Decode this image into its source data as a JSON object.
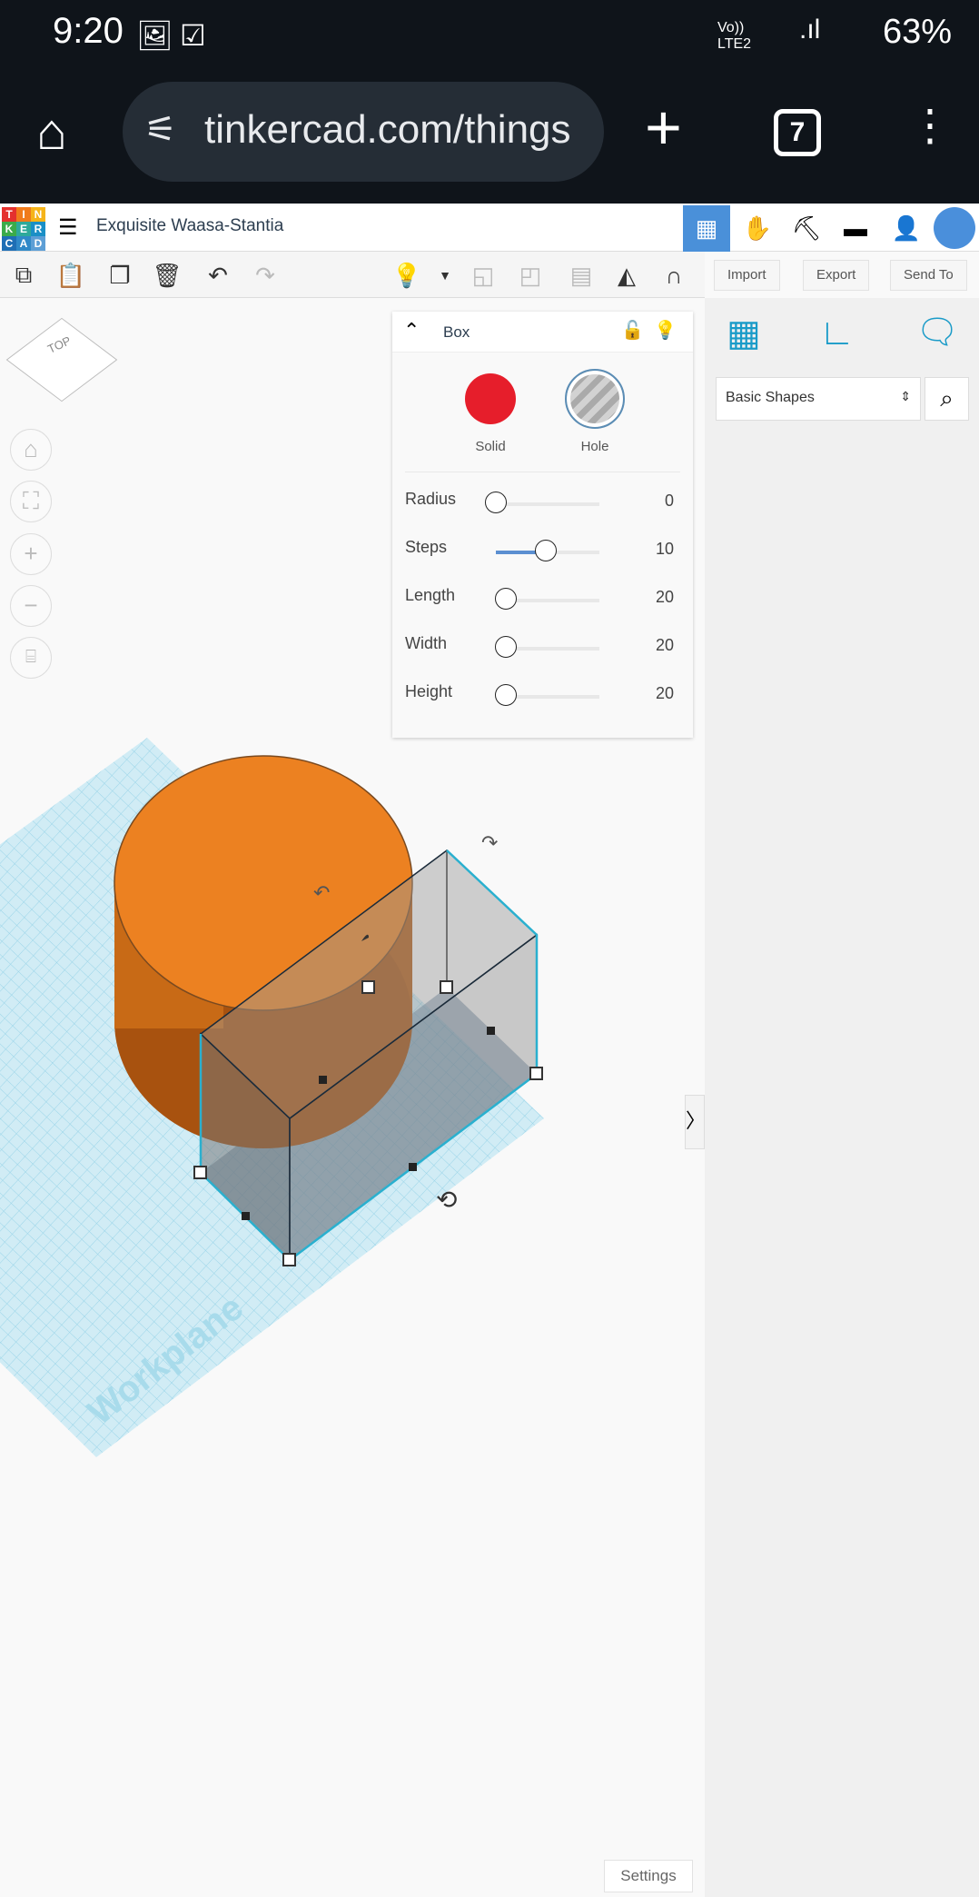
{
  "status_bar": {
    "time": "9:20",
    "battery": "63%",
    "network": "Vo)) LTE2"
  },
  "browser": {
    "url": "tinkercad.com/things",
    "tab_count": "7"
  },
  "app": {
    "title": "Exquisite Waasa-Stantia",
    "logo": [
      "T",
      "I",
      "N",
      "K",
      "E",
      "R",
      "C",
      "A",
      "D"
    ]
  },
  "toolbar": {
    "import": "Import",
    "export": "Export",
    "send_to": "Send To"
  },
  "inspector": {
    "shape_name": "Box",
    "solid_label": "Solid",
    "hole_label": "Hole",
    "solid_color": "#e61e2b",
    "selected": "Hole",
    "params": [
      {
        "label": "Radius",
        "value": "0",
        "fraction": 0
      },
      {
        "label": "Steps",
        "value": "10",
        "fraction": 0.5
      },
      {
        "label": "Length",
        "value": "20",
        "fraction": 0.1
      },
      {
        "label": "Width",
        "value": "20",
        "fraction": 0.1
      },
      {
        "label": "Height",
        "value": "20",
        "fraction": 0.1
      }
    ]
  },
  "viewcube": {
    "face": "TOP"
  },
  "workplane": {
    "label": "Workplane"
  },
  "library": {
    "category": "Basic Shapes"
  },
  "settings": "Settings"
}
